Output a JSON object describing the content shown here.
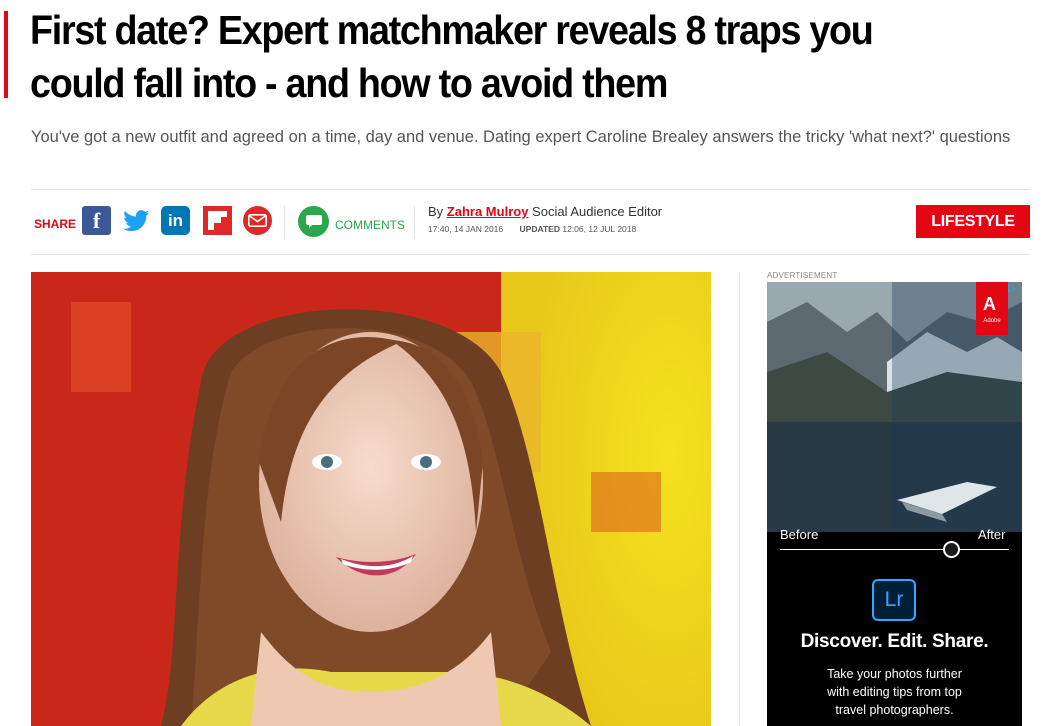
{
  "article": {
    "headline": "First date? Expert matchmaker reveals 8 traps you could fall into - and how to avoid them",
    "standfirst": "You've got a new outfit and agreed on a time, day and venue. Dating expert Caroline Brealey answers the tricky 'what next?' questions",
    "accent_color": "#e30613"
  },
  "share": {
    "label": "SHARE",
    "icons": [
      "facebook-icon",
      "twitter-icon",
      "linkedin-icon",
      "flipboard-icon",
      "email-icon"
    ],
    "facebook_glyph": "f",
    "linkedin_glyph": "in"
  },
  "comments": {
    "label": "COMMENTS",
    "icon": "speech-bubble-icon",
    "color": "#2aa64c"
  },
  "byline": {
    "prefix": "By",
    "author": "Zahra Mulroy",
    "role": "Social Audience Editor",
    "published": "17:40, 14 JAN 2016",
    "updated_label": "UPDATED",
    "updated": "12:06, 12 JUL 2018"
  },
  "section_tag": "LIFESTYLE",
  "advert": {
    "label": "ADVERTISEMENT",
    "brand": "Adobe",
    "brand_letter": "A",
    "before": "Before",
    "after": "After",
    "product_mark": "Lr",
    "headline": "Discover. Edit. Share.",
    "body_line1": "Take your photos further",
    "body_line2": "with editing tips from top",
    "body_line3": "travel photographers.",
    "adchoices_icon": "adchoices-icon"
  }
}
